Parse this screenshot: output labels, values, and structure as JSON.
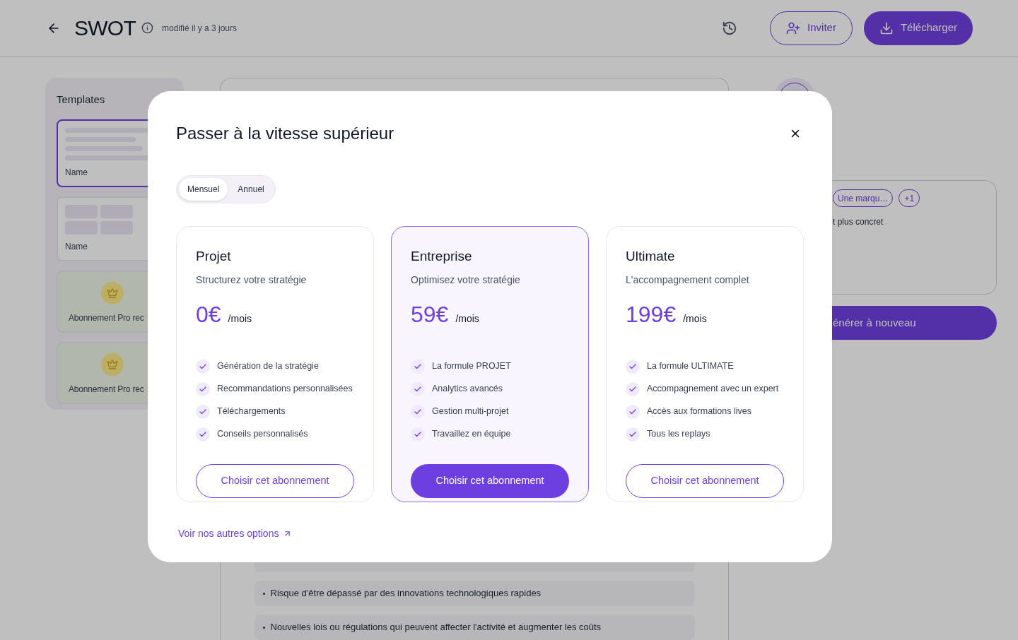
{
  "header": {
    "title": "SWOT",
    "modified": "modifié il y a 3 jours",
    "buttons": [
      {
        "label": "Inviter",
        "kind": "outline"
      },
      {
        "label": "Télécharger",
        "kind": "primary"
      }
    ]
  },
  "sidebar": {
    "title": "Templates",
    "items": [
      {
        "name": "Name",
        "kind": "lines",
        "selected": true
      },
      {
        "name": "Name",
        "kind": "grid",
        "selected": false
      },
      {
        "name": "Abonnement Pro rec",
        "kind": "pro",
        "selected": false
      },
      {
        "name": "Abonnement Pro rec",
        "kind": "pro",
        "selected": false
      }
    ]
  },
  "content": {
    "rows": [
      "Risque d'être dépassé par des innovations technologiques rapides",
      "Nouvelles lois ou régulations qui peuvent affecter l'activité et augmenter les coûts"
    ]
  },
  "right_panel": {
    "chips": [
      "Une marqu…",
      "+1"
    ],
    "text": "t plus concret",
    "button": "énérer à nouveau"
  },
  "modal": {
    "title": "Passer à la vitesse supérieur",
    "billing": [
      {
        "label": "Mensuel",
        "selected": true
      },
      {
        "label": "Annuel",
        "selected": false
      }
    ],
    "plans": [
      {
        "name": "Projet",
        "subtitle": "Structurez votre stratégie",
        "price": "0€",
        "period": "/mois",
        "features": [
          "Génération de la stratégie",
          "Recommandations personnalisées",
          "Téléchargements",
          "Conseils personnalisés"
        ],
        "button": "Choisir cet abonnement",
        "selected": false
      },
      {
        "name": "Entreprise",
        "subtitle": "Optimisez votre stratégie",
        "price": "59€",
        "period": "/mois",
        "features": [
          "La formule PROJET",
          "Analytics avancés",
          "Gestion multi-projet",
          "Travaillez en équipe"
        ],
        "button": "Choisir cet abonnement",
        "selected": true
      },
      {
        "name": "Ultimate",
        "subtitle": "L'accompagnement complet",
        "price": "199€",
        "period": "/mois",
        "features": [
          "La formule ULTIMATE",
          "Accompagnement avec un expert",
          "Accès aux formations lives",
          "Tous les replays"
        ],
        "button": "Choisir cet abonnement",
        "selected": false
      }
    ],
    "link": "Voir nos autres options"
  }
}
